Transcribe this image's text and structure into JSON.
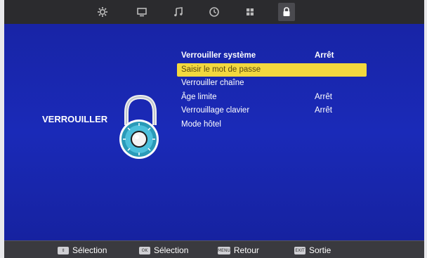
{
  "tabs": [
    {
      "icon": "settings-icon"
    },
    {
      "icon": "monitor-icon"
    },
    {
      "icon": "music-note-icon"
    },
    {
      "icon": "clock-icon"
    },
    {
      "icon": "grid-icon"
    },
    {
      "icon": "lock-icon",
      "active": true
    }
  ],
  "section": {
    "title": "VERROUILLER"
  },
  "menu": {
    "items": [
      {
        "label": "Verrouiller système",
        "value": "Arrêt"
      },
      {
        "label": "Saisir le mot de passe",
        "value": ""
      },
      {
        "label": "Verrouiller chaîne",
        "value": ""
      },
      {
        "label": "Âge limite",
        "value": "Arrêt"
      },
      {
        "label": "Verrouillage clavier",
        "value": "Arrêt"
      },
      {
        "label": "Mode hôtel",
        "value": ""
      }
    ],
    "selected_index": 1
  },
  "footer": {
    "hints": [
      {
        "key": "⇕",
        "label": "Sélection"
      },
      {
        "key": "OK",
        "label": "Sélection"
      },
      {
        "key": "MENU",
        "label": "Retour"
      },
      {
        "key": "EXIT",
        "label": "Sortie"
      }
    ]
  },
  "colors": {
    "background": "#1a2ab8",
    "highlight": "#f3d83e",
    "topbar": "#2b2b2e",
    "bottombar": "#3a3a3f"
  }
}
